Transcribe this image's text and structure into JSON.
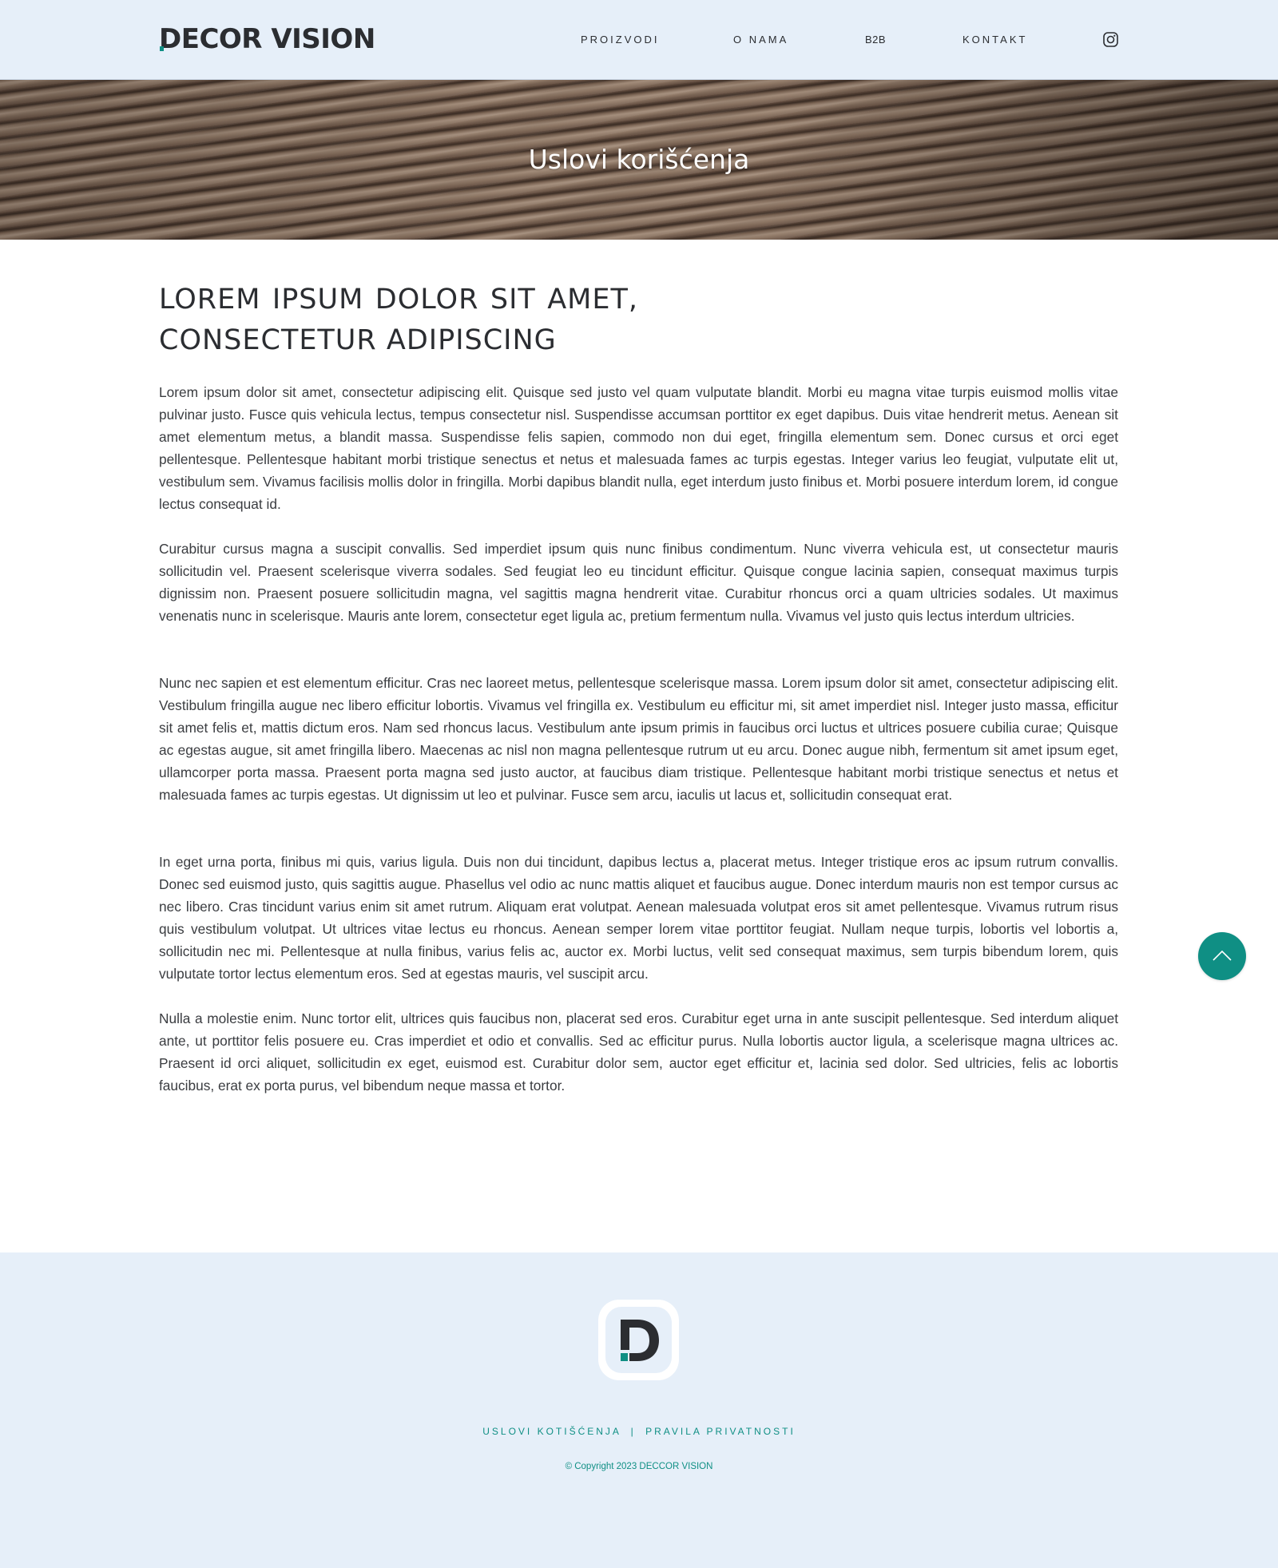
{
  "header": {
    "logo_text": "DECOR VISION",
    "nav": [
      {
        "label": "PROIZVODI"
      },
      {
        "label": "O NAMA"
      },
      {
        "label": "B2B"
      },
      {
        "label": "KONTAKT"
      }
    ],
    "social_icon": "instagram-icon"
  },
  "hero": {
    "title": "Uslovi korišćenja"
  },
  "content": {
    "heading": "LOREM IPSUM DOLOR SIT AMET, CONSECTETUR ADIPISCING",
    "paragraphs": [
      "Lorem ipsum dolor sit amet, consectetur adipiscing elit. Quisque sed justo vel quam vulputate blandit. Morbi eu magna vitae turpis euismod mollis vitae pulvinar justo. Fusce quis vehicula lectus, tempus consectetur nisl. Suspendisse accumsan porttitor ex eget dapibus. Duis vitae hen­drerit metus. Aenean sit amet elementum metus, a blandit massa. Suspendisse felis sapien, commodo non dui eget, fringilla elementum sem. Donec cursus et orci eget pellentesque. Pellentesque habitant morbi tristique senectus et netus et malesuada fames ac turpis egestas. Integer varius leo feugiat, vulputate elit ut, vestibulum sem. Vivamus facilisis mollis dolor in fringilla. Morbi dapibus blandit nulla, eget interdum justo finibus et. Morbi posuere interdum lorem, id congue lectus consequat id.",
      "Curabitur cursus magna a suscipit convallis. Sed imperdiet ipsum quis nunc finibus condimentum. Nunc viverra vehicula est, ut consectetur mauris sollicitudin vel. Praesent scelerisque viverra sodales. Sed feugiat leo eu tincidunt efficitur. Quisque congue lacinia sapien, consequat max­imus turpis dignissim non. Praesent posuere sollicitudin magna, vel sagittis magna hendrerit vitae. Curabitur rhoncus orci a quam ultricies so­dales. Ut maximus venenatis nunc in scelerisque. Mauris ante lorem, consectetur eget ligula ac, pretium fermentum nulla. Vivamus vel justo quis lectus interdum ultricies.",
      "Nunc nec sapien et est elementum efficitur. Cras nec laoreet metus, pellentesque scelerisque massa. Lorem ipsum dolor sit amet, consectetur adipiscing elit. Vestibulum fringilla augue nec libero efficitur lobortis. Vivamus vel fringilla ex. Vestibulum eu efficitur mi, sit amet imperdiet nisl. Integer justo massa, efficitur sit amet felis et, mattis dictum eros. Nam sed rhoncus lacus. Vestibulum ante ipsum primis in faucibus orci luctus et ultrices posuere cubilia curae; Quisque ac egestas augue, sit amet fringilla libero. Maecenas ac nisl non magna pellentesque rutrum ut eu arcu. Donec augue nibh, fermentum sit amet ipsum eget, ullamcorper porta massa. Praesent porta magna sed justo auctor, at faucibus diam tristique. Pellentesque habitant morbi tristique senectus et netus et malesuada fames ac turpis egestas. Ut dignissim ut leo et pulvinar. Fusce sem arcu, iaculis ut lacus et, sollicitudin consequat erat.",
      "In eget urna porta, finibus mi quis, varius ligula. Duis non dui tincidunt, dapibus lectus a, placerat metus. Integer tristique eros ac ipsum rutrum convallis. Donec sed euismod justo, quis sagittis augue. Phasellus vel odio ac nunc mattis aliquet et faucibus augue. Donec interdum mauris non est tempor cursus ac nec libero. Cras tincidunt varius enim sit amet rutrum. Aliquam erat volutpat. Aenean malesuada volutpat eros sit amet pel­lentesque. Vivamus rutrum risus quis vestibulum volutpat. Ut ultrices vitae lectus eu rhoncus. Aenean semper lorem vitae porttitor feugiat. Nullam neque turpis, lobortis vel lobortis a, sollicitudin nec mi. Pellentesque at nulla finibus, varius felis ac, auctor ex. Morbi luctus, velit sed con­sequat maximus, sem turpis bibendum lorem, quis vulputate tortor lectus elementum eros. Sed at egestas mauris, vel suscipit arcu.",
      "Nulla a molestie enim. Nunc tortor elit, ultrices quis faucibus non, placerat sed eros. Curabitur eget urna in ante suscipit pellentesque. Sed inter­dum aliquet ante, ut porttitor felis posuere eu. Cras imperdiet et odio et convallis. Sed ac efficitur purus. Nulla lobortis auctor ligula, a scelerisque magna ultrices ac. Praesent id orci aliquet, sollicitudin ex eget, euismod est. Curabitur dolor sem, auctor eget efficitur et, lacinia sed dolor. Sed ul­tricies, felis ac lobortis faucibus, erat ex porta purus, vel bibendum neque massa et tortor."
    ]
  },
  "back_to_top": {
    "icon": "chevron-up-icon"
  },
  "footer": {
    "logo_icon": "decor-vision-d-logo",
    "links": [
      {
        "label": "USLOVI KOTIŠĆENJA"
      },
      {
        "label": "PRAVILA PRIVATNOSTI"
      }
    ],
    "separator": "|",
    "copyright": "© Copyright 2023 DECCOR VISION"
  },
  "colors": {
    "accent": "#0f8f84",
    "header_bg": "#e6eff9",
    "text": "#2b2d31"
  }
}
